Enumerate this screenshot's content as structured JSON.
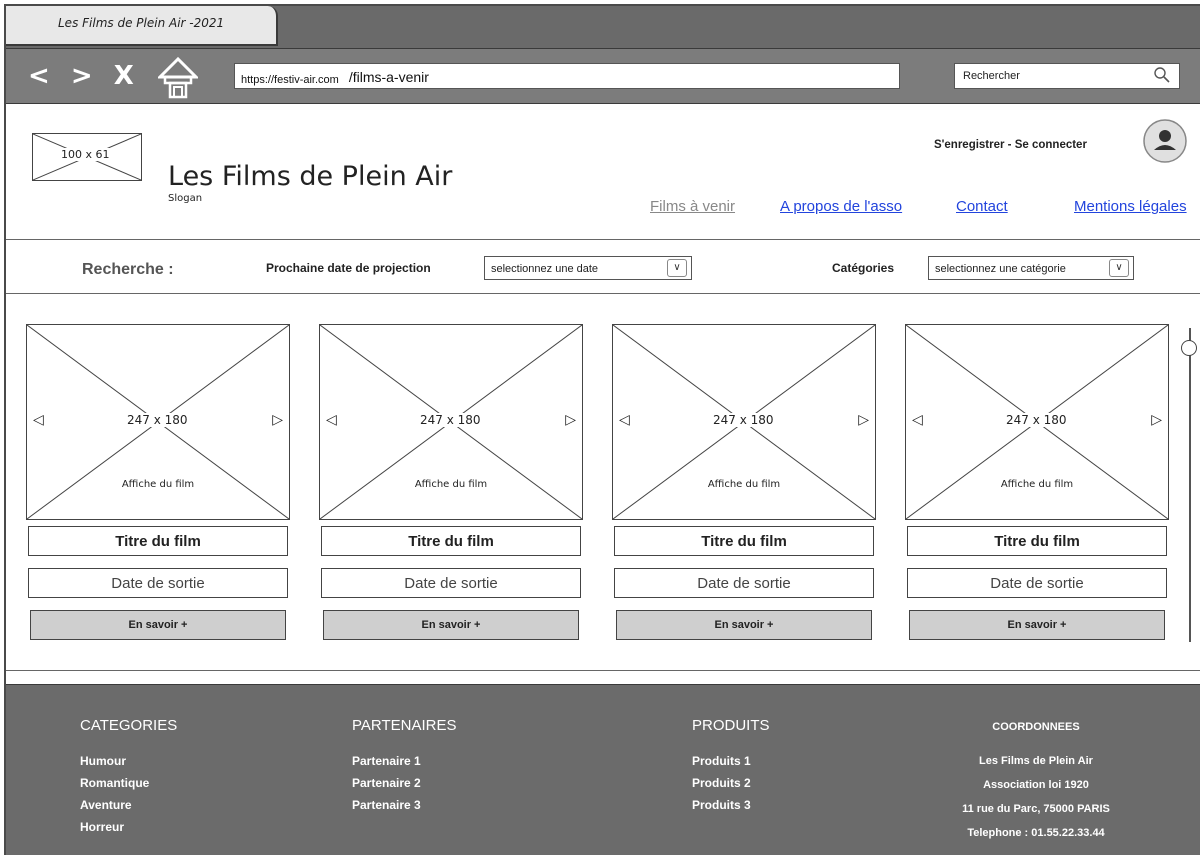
{
  "browser": {
    "tab_title": "Les Films de Plein Air -2021",
    "nav": {
      "back": "<",
      "forward": ">",
      "close": "X"
    },
    "url_domain": "https://festiv-air.com",
    "url_path": "/films-a-venir",
    "search_placeholder": "Rechercher"
  },
  "header": {
    "logo_placeholder": "100 x 61",
    "site_title": "Les Films de Plein Air",
    "slogan": "Slogan",
    "auth": "S'enregistrer  -  Se connecter",
    "nav": [
      {
        "label": "Films à venir"
      },
      {
        "label": "A propos de l'asso"
      },
      {
        "label": "Contact"
      },
      {
        "label": "Mentions légales"
      }
    ]
  },
  "search": {
    "label": "Recherche :",
    "date_label": "Prochaine date de projection",
    "date_select": "selectionnez une date",
    "cat_label": "Catégories",
    "cat_select": "selectionnez une catégorie"
  },
  "cards": [
    {
      "poster_dim": "247 x 180",
      "poster_caption": "Affiche du film",
      "title": "Titre du film",
      "date": "Date de sortie",
      "button": "En savoir +"
    },
    {
      "poster_dim": "247 x 180",
      "poster_caption": "Affiche du film",
      "title": "Titre du film",
      "date": "Date de sortie",
      "button": "En savoir +"
    },
    {
      "poster_dim": "247 x 180",
      "poster_caption": "Affiche du film",
      "title": "Titre du film",
      "date": "Date de sortie",
      "button": "En savoir +"
    },
    {
      "poster_dim": "247 x 180",
      "poster_caption": "Affiche du film",
      "title": "Titre du film",
      "date": "Date de sortie",
      "button": "En savoir +"
    }
  ],
  "footer": {
    "categories": {
      "heading": "CATEGORIES",
      "items": [
        "Humour",
        "Romantique",
        "Aventure",
        "Horreur"
      ]
    },
    "partners": {
      "heading": "PARTENAIRES",
      "items": [
        "Partenaire 1",
        "Partenaire 2",
        "Partenaire 3"
      ]
    },
    "products": {
      "heading": "PRODUITS",
      "items": [
        "Produits 1",
        "Produits 2",
        "Produits 3"
      ]
    },
    "contact": {
      "heading": "COORDONNEES",
      "lines": [
        "Les Films de Plein Air",
        "Association loi 1920",
        "11 rue du Parc, 75000 PARIS",
        "Telephone : 01.55.22.33.44"
      ]
    }
  },
  "colors": {
    "link": "#2244dd",
    "chrome": "#7c7c7c",
    "footer_bg": "#6b6b6b",
    "button_bg": "#cfcfcf"
  }
}
